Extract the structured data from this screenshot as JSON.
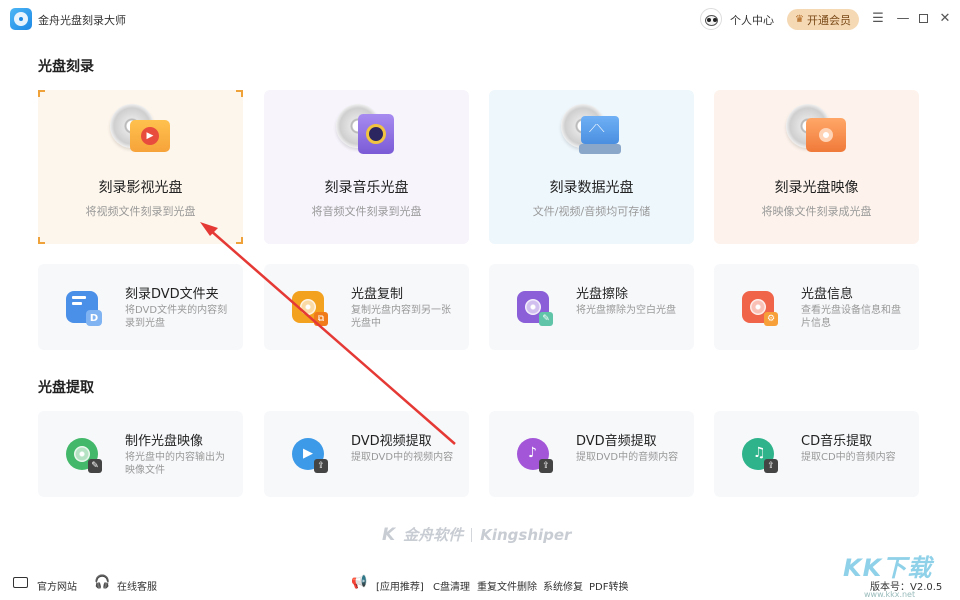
{
  "app": {
    "title": "金舟光盘刻录大师",
    "user_center": "个人中心",
    "vip_label": "开通会员"
  },
  "window_controls": [
    "menu-icon",
    "minimize-icon",
    "maximize-icon",
    "close-icon"
  ],
  "sections": {
    "burn_title": "光盘刻录",
    "extract_title": "光盘提取"
  },
  "big_cards": [
    {
      "title": "刻录影视光盘",
      "desc": "将视频文件刻录到光盘",
      "bg": "#fdf6ec",
      "accent": "#f6a33a"
    },
    {
      "title": "刻录音乐光盘",
      "desc": "将音频文件刻录到光盘",
      "bg": "#f7f4fc",
      "accent": "#7b5bd6"
    },
    {
      "title": "刻录数据光盘",
      "desc": "文件/视频/音频均可存储",
      "bg": "#eef7fc",
      "accent": "#4a8fe0"
    },
    {
      "title": "刻录光盘映像",
      "desc": "将映像文件刻录成光盘",
      "bg": "#fdf3ec",
      "accent": "#f07a3a"
    }
  ],
  "tool_cards": [
    {
      "title": "刻录DVD文件夹",
      "desc": "将DVD文件夹的内容刻录到光盘",
      "color": "#4a8fe8"
    },
    {
      "title": "光盘复制",
      "desc": "复制光盘内容到另一张光盘中",
      "color": "#f3a21f"
    },
    {
      "title": "光盘擦除",
      "desc": "将光盘擦除为空白光盘",
      "color": "#8b5fd8"
    },
    {
      "title": "光盘信息",
      "desc": "查看光盘设备信息和盘片信息",
      "color": "#f0644a"
    }
  ],
  "extract_cards": [
    {
      "title": "制作光盘映像",
      "desc": "将光盘中的内容输出为映像文件",
      "color": "#43b86a"
    },
    {
      "title": "DVD视频提取",
      "desc": "提取DVD中的视频内容",
      "color": "#3d9ae8"
    },
    {
      "title": "DVD音频提取",
      "desc": "提取DVD中的音频内容",
      "color": "#a357d8"
    },
    {
      "title": "CD音乐提取",
      "desc": "提取CD中的音频内容",
      "color": "#2fb38a"
    }
  ],
  "brand": {
    "cn": "金舟软件",
    "en": "Kingshiper"
  },
  "footer": {
    "official_site": "官方网站",
    "online_service": "在线客服",
    "recommend": "[应用推荐]",
    "links": [
      "C盘清理",
      "重复文件删除",
      "系统修复",
      "PDF转换"
    ],
    "version": "版本号：V2.0.5"
  },
  "watermark": {
    "kk": "KK下载",
    "url": "www.kkx.net"
  }
}
